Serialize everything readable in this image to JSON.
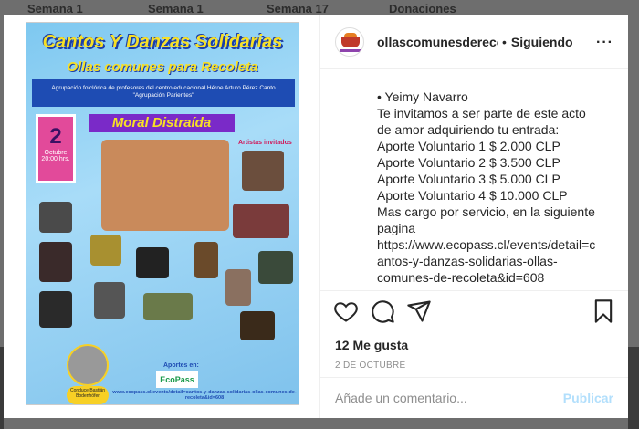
{
  "background": {
    "tabs": [
      "Semana 1",
      "Semana 1",
      "Semana 17",
      "Donaciones"
    ]
  },
  "poster": {
    "title": "Cantos Y Danzas Solidarias",
    "subtitle": "Ollas comunes para Recoleta",
    "band_line1": "Agrupación folclórica de profesores del centro educacional Héroe Arturo Pérez Canto",
    "band_line2": "\"Agrupación Parientes\"",
    "date_day": "2",
    "date_month": "Octubre",
    "date_time": "20:00 hrs.",
    "headliner": "Moral Distraída",
    "artists_heading": "Artistas invitados",
    "aportes": "Aportes en:",
    "ecopass": "EcoPass",
    "url": "www.ecopass.cl/events/detail=cantos-y-danzas-solidarias-ollas-comunes-de-recoleta&id=608",
    "conduce": "Conduce Bastián Bodenhöfer"
  },
  "post": {
    "username": "ollascomunesderecoleta",
    "following_label": "Siguiendo",
    "more_icon": "more-horizontal-icon",
    "caption_lines": [
      "• Yeimy Navarro",
      "Te invitamos a ser parte de este acto",
      "de amor adquiriendo tu entrada:",
      "Aporte Voluntario 1 $ 2.000 CLP",
      "Aporte Voluntario 2 $ 3.500 CLP",
      "Aporte Voluntario 3 $ 5.000 CLP",
      "Aporte Voluntario 4 $ 10.000 CLP",
      "Mas cargo por servicio, en la siguiente",
      "pagina",
      "https://www.ecopass.cl/events/detail=c",
      "antos-y-danzas-solidarias-ollas-",
      "comunes-de-recoleta&id=608"
    ],
    "likes": "12 Me gusta",
    "date": "2 DE OCTUBRE",
    "comment_placeholder": "Añade un comentario...",
    "publish_label": "Publicar"
  }
}
